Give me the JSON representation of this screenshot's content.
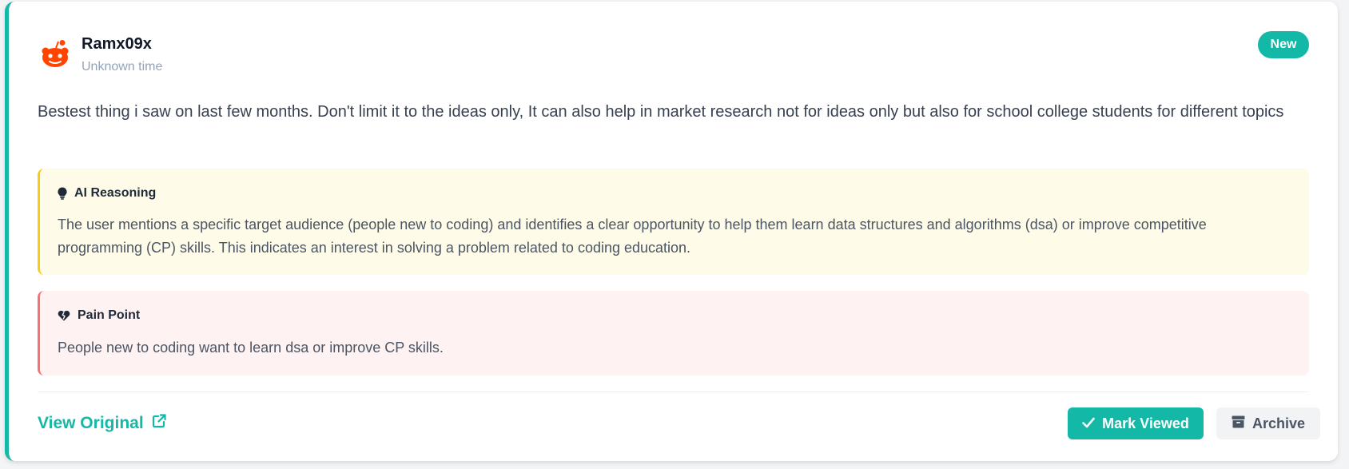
{
  "post": {
    "author": "Ramx09x",
    "time": "Unknown time",
    "badge": "New",
    "avatar_icon": "reddit-icon",
    "content": "Bestest thing i saw on last few months. Don't limit it to the ideas only, It can also help in market research not for ideas only but also for school college students for different topics"
  },
  "reasoning": {
    "title": "AI Reasoning",
    "icon": "lightbulb-icon",
    "text": "The user mentions a specific target audience (people new to coding) and identifies a clear opportunity to help them learn data structures and algorithms (dsa) or improve competitive programming (CP) skills. This indicates an interest in solving a problem related to coding education."
  },
  "pain_point": {
    "title": "Pain Point",
    "icon": "heart-crack-icon",
    "text": "People new to coding want to learn dsa or improve CP skills."
  },
  "actions": {
    "view_original": "View Original",
    "mark_viewed": "Mark Viewed",
    "archive": "Archive"
  },
  "colors": {
    "accent": "#14b8a6",
    "reasoning_bg": "#fefce8",
    "reasoning_border": "#facc15",
    "pain_bg": "#fef2f2",
    "pain_border": "#f87171",
    "reddit_orange": "#ff4500"
  }
}
